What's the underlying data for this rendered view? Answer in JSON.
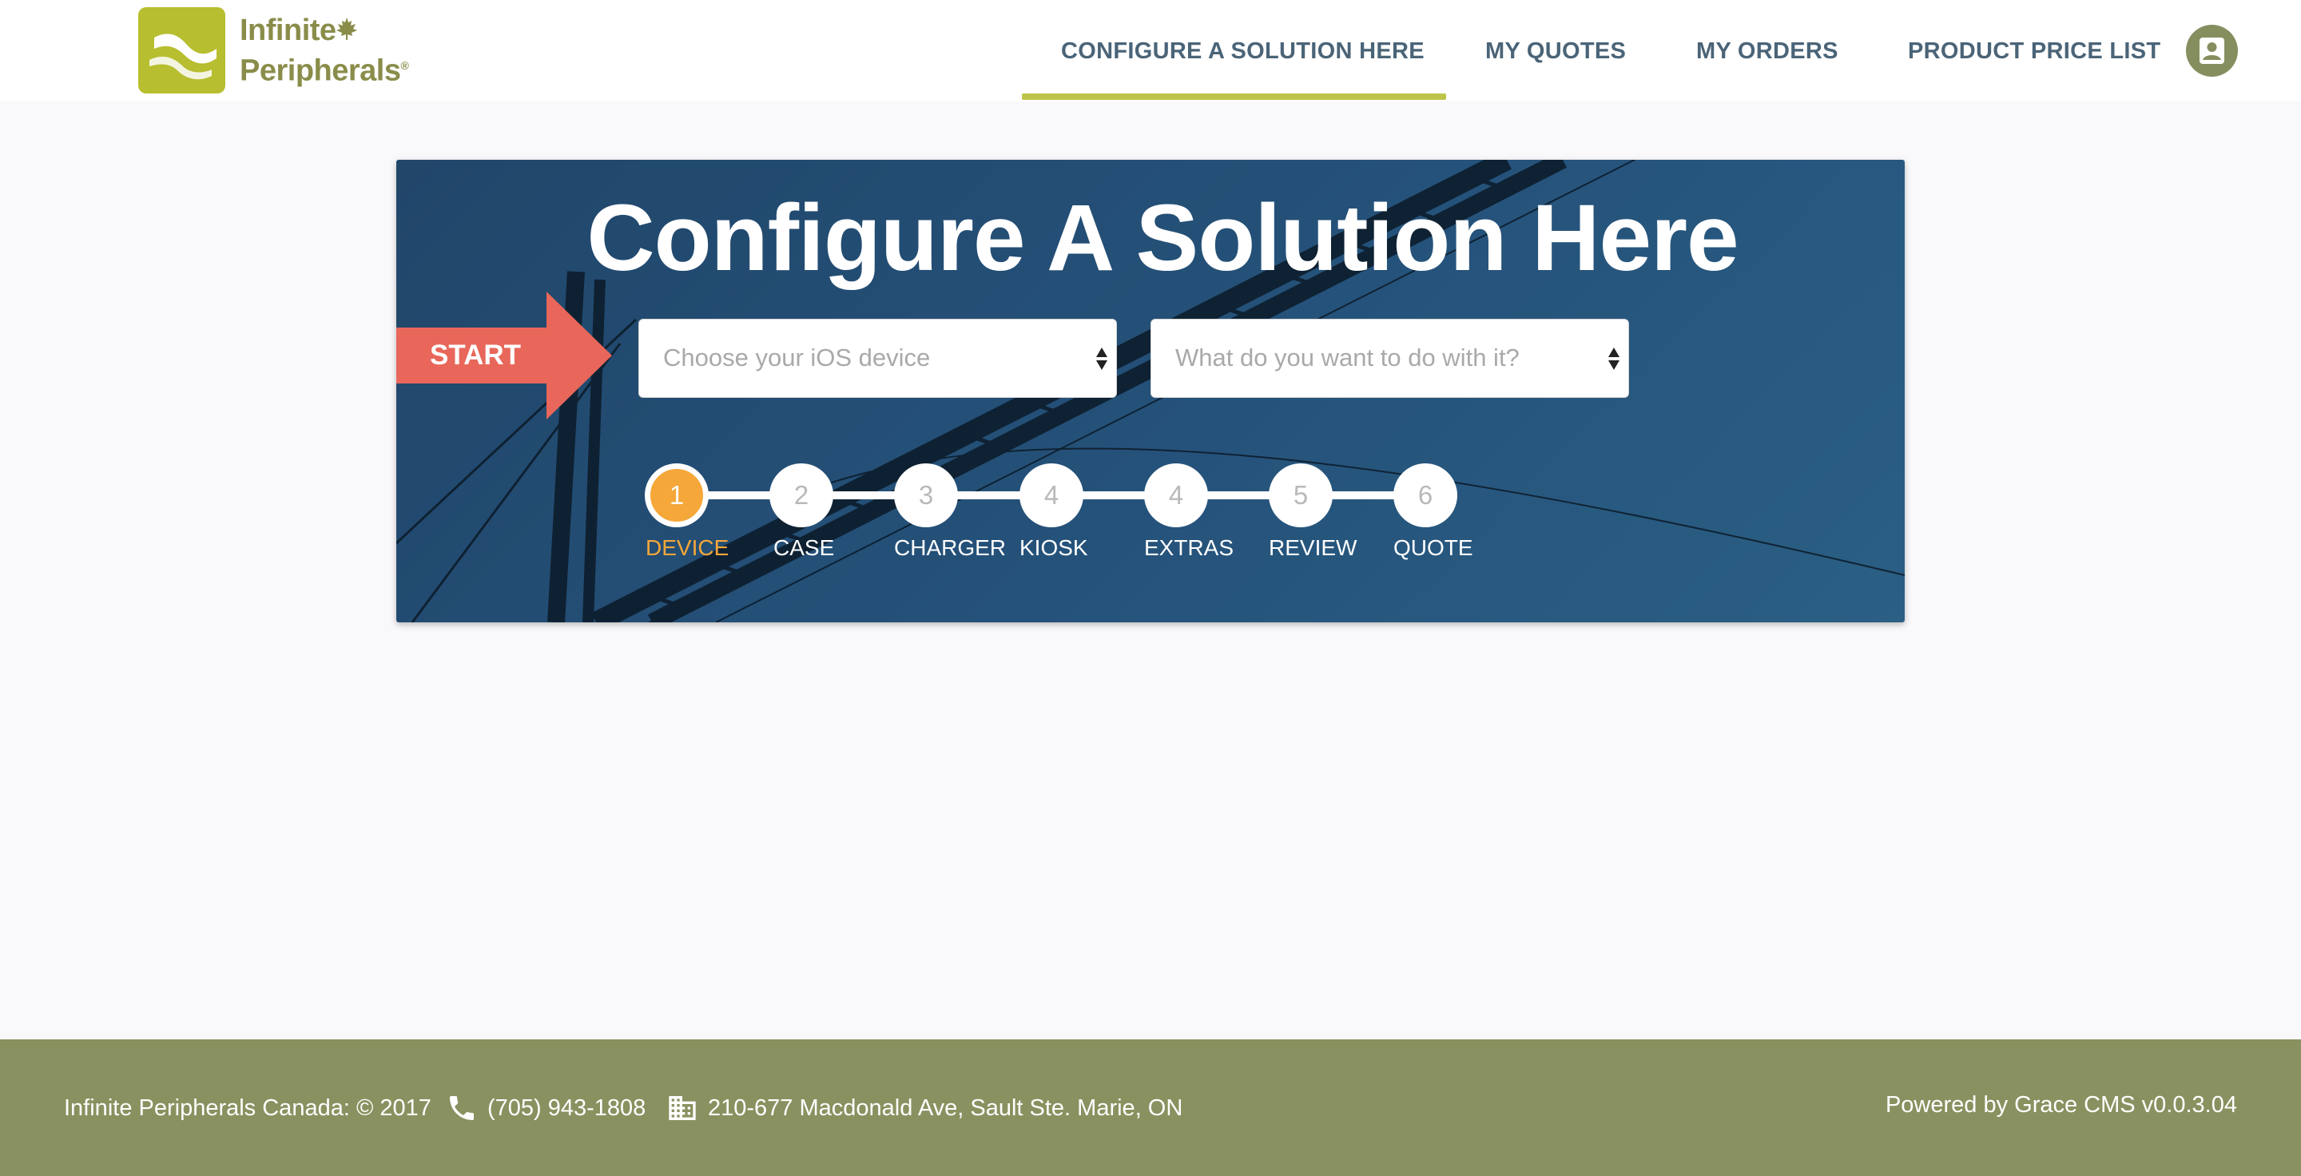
{
  "header": {
    "logo": {
      "line1": "Infinite",
      "line2": "Peripherals",
      "reg": "®"
    },
    "nav": [
      {
        "label": "CONFIGURE A SOLUTION HERE",
        "active": true
      },
      {
        "label": "MY QUOTES",
        "active": false
      },
      {
        "label": "MY ORDERS",
        "active": false
      },
      {
        "label": "PRODUCT PRICE LIST",
        "active": false
      }
    ],
    "user_icon": "user-account-icon"
  },
  "hero": {
    "title": "Configure A Solution Here",
    "start_label": "START",
    "device_select": {
      "placeholder": "Choose your iOS device"
    },
    "purpose_select": {
      "placeholder": "What do you want to do with it?"
    },
    "steps": [
      {
        "number": "1",
        "label": "DEVICE",
        "active": true
      },
      {
        "number": "2",
        "label": "CASE",
        "active": false
      },
      {
        "number": "3",
        "label": "CHARGER",
        "active": false
      },
      {
        "number": "4",
        "label": "KIOSK",
        "active": false
      },
      {
        "number": "4",
        "label": "EXTRAS",
        "active": false
      },
      {
        "number": "5",
        "label": "REVIEW",
        "active": false
      },
      {
        "number": "6",
        "label": "QUOTE",
        "active": false
      }
    ]
  },
  "footer": {
    "company": "Infinite Peripherals Canada: © 2017",
    "phone": "(705) 943-1808",
    "address": "210-677 Macdonald Ave, Sault Ste. Marie, ON",
    "powered_by": "Powered by Grace CMS v0.0.3.04"
  },
  "colors": {
    "brand_green": "#b7be2f",
    "nav_text": "#4a6478",
    "active_bar": "#bdc44a",
    "hero_bg": "#25527a",
    "start_red": "#e8675a",
    "step_active": "#f5a73a",
    "footer_bg": "#8a9160"
  }
}
